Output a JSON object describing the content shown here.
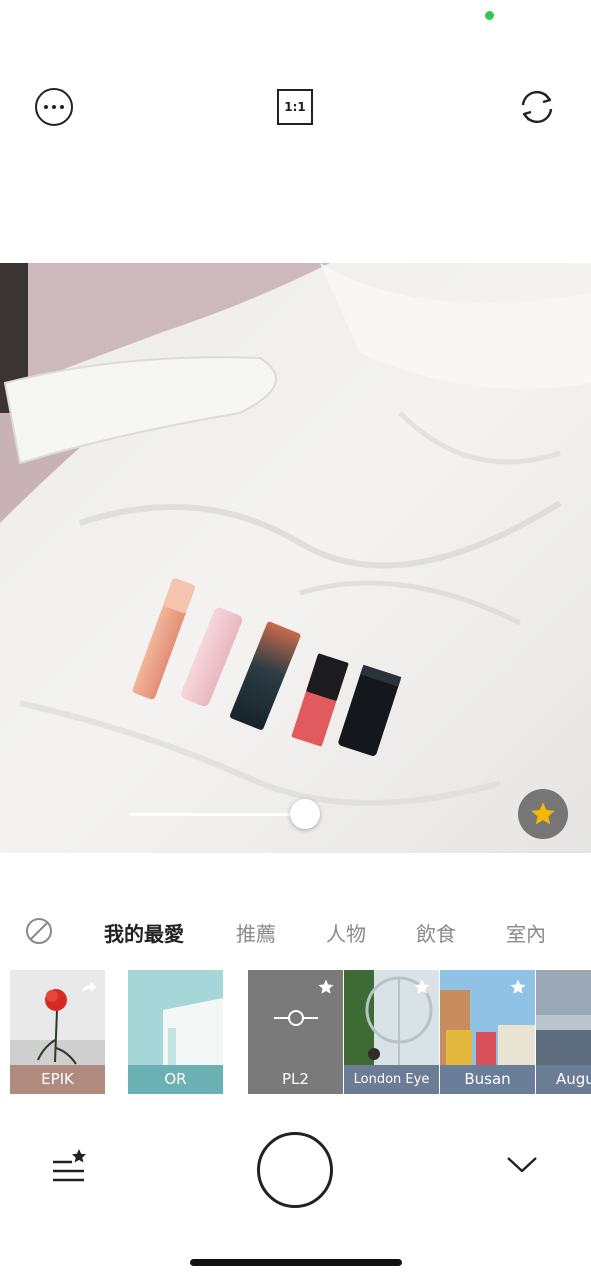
{
  "status": {
    "dot_color": "#34c759"
  },
  "toolbar": {
    "more_icon": "more-horizontal-icon",
    "ratio_label": "1:1",
    "switch_icon": "camera-switch-icon"
  },
  "viewfinder": {
    "intensity_level": 0.97,
    "favorite_icon": "star-icon",
    "favorite_color": "#f5b800"
  },
  "categories": {
    "none_icon": "no-filter-icon",
    "tabs": [
      "我的最愛",
      "推薦",
      "人物",
      "飲食",
      "室內"
    ],
    "active_index": 0
  },
  "filters": [
    {
      "label": "EPIK",
      "label_bg": "#b08a7e",
      "icon": "share-icon"
    },
    {
      "label": "OR",
      "label_bg": "#6bb0b3"
    },
    {
      "label": "PL2",
      "label_bg": "#7a7a7a",
      "icon": "star-icon"
    },
    {
      "label": "London Eye",
      "label_bg": "#6b7c95",
      "icon": "star-icon"
    },
    {
      "label": "Busan",
      "label_bg": "#6a7e9a",
      "icon": "star-icon"
    },
    {
      "label": "Augu",
      "label_bg": "#6b7c95"
    }
  ],
  "bottom_bar": {
    "favorites_list_icon": "favorites-list-icon",
    "shutter_icon": "shutter-button",
    "collapse_icon": "chevron-down-icon"
  }
}
